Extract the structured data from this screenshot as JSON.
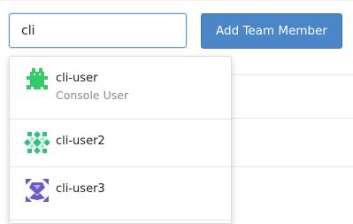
{
  "search": {
    "value": "cli"
  },
  "add_button": {
    "label": "Add Team Member"
  },
  "dropdown": {
    "options": [
      {
        "name": "cli-user",
        "subtitle": "Console User",
        "avatar_icon": "bug-identicon-icon",
        "avatar_color": "#33cc66"
      },
      {
        "name": "cli-user2",
        "subtitle": "",
        "avatar_icon": "diamond-identicon-icon",
        "avatar_color": "#2ec27e"
      },
      {
        "name": "cli-user3",
        "subtitle": "",
        "avatar_icon": "star-identicon-icon",
        "avatar_color": "#6a5acd"
      }
    ]
  },
  "colors": {
    "primary": "#4a86c8",
    "input_focus_border": "#5b9bd5",
    "muted_text": "#8a8a8a"
  }
}
